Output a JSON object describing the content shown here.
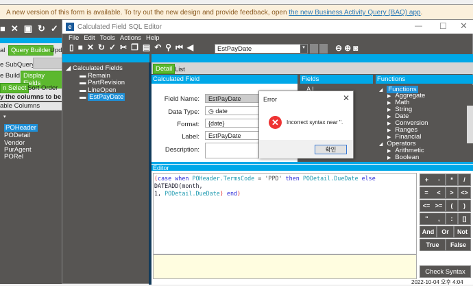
{
  "banner": {
    "text": "A new version of this form is available. To try out the new design and provide feedback, open ",
    "link": "the new Business Activity Query (BAQ) app",
    "end": "."
  },
  "background": {
    "tabs": [
      "al",
      "Query Builder",
      "Upd"
    ],
    "subquery_label": "e SubQuery:",
    "subtabs1": [
      "e Build",
      "Display Fields"
    ],
    "subtabs2": [
      "n Select",
      "Sort Order"
    ],
    "instruction": "y the columns to be disp",
    "available": "able Columns",
    "tables": [
      "POHeader",
      "PODetail",
      "Vendor",
      "PurAgent",
      "PORel"
    ]
  },
  "window": {
    "title": "Calculated Field SQL Editor",
    "menu": [
      "File",
      "Edit",
      "Tools",
      "Actions",
      "Help"
    ],
    "nav_value": "EstPayDate",
    "tree": {
      "root": "Calculated Fields",
      "items": [
        "Remain",
        "PartRevision",
        "LineOpen",
        "EstPayDate"
      ],
      "selected": "EstPayDate"
    },
    "tabs": [
      "Detail",
      "List"
    ],
    "calc_header": "Calculated Field",
    "form": {
      "field_name_label": "Field Name:",
      "field_name": "EstPayDate",
      "data_type_label": "Data Type:",
      "data_type": "date",
      "format_label": "Format:",
      "format": "{date}",
      "label_label": "Label:",
      "label": "EstPayDate",
      "description_label": "Description:",
      "description": ""
    },
    "fields_header": "Fields",
    "fields_partial": [
      "A l",
      "ds",
      "ls"
    ],
    "functions_header": "Functions",
    "functions": {
      "root": "Functions",
      "items": [
        "Aggregate",
        "Math",
        "String",
        "Date",
        "Conversion",
        "Ranges",
        "Financial"
      ],
      "operators": "Operators",
      "op_items": [
        "Arithmetic",
        "Boolean"
      ]
    },
    "editor_header": "Editor",
    "code": {
      "line1": [
        "(",
        "case when ",
        "POHeader.TermsCode",
        " = ",
        "'PPD'",
        " then ",
        "PODetail.DueDate",
        " else ",
        "DATEADD",
        "(month,"
      ],
      "line2": [
        "1, ",
        "PODetail.DueDate",
        ")",
        " end",
        ")"
      ]
    },
    "keypad": [
      [
        "+",
        "-",
        "*",
        "/"
      ],
      [
        "=",
        "<",
        ">",
        "<>"
      ],
      [
        "<=",
        ">=",
        "(",
        ")"
      ],
      [
        "\"",
        ",",
        ":",
        "[]"
      ]
    ],
    "logic": [
      "And",
      "Or",
      "Not"
    ],
    "bool": [
      "True",
      "False"
    ],
    "check_syntax": "Check Syntax"
  },
  "dialog": {
    "title": "Error",
    "message": "Incorrect syntax near ''.",
    "ok": "확인"
  },
  "taskbar": {
    "clock": "2022-10-04 오후 4:04"
  }
}
